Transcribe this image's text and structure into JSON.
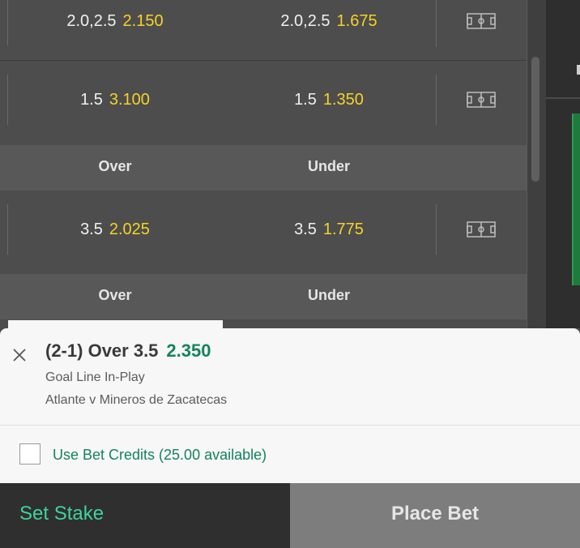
{
  "market": {
    "rows": [
      {
        "left_handicap": "2.0,2.5",
        "left_price": "2.150",
        "right_handicap": "2.0,2.5",
        "right_price": "1.675"
      },
      {
        "left_handicap": "1.5",
        "left_price": "3.100",
        "right_handicap": "1.5",
        "right_price": "1.350"
      },
      {
        "left_handicap": "3.5",
        "left_price": "2.025",
        "right_handicap": "3.5",
        "right_price": "1.775"
      }
    ],
    "headers": [
      {
        "left": "Over",
        "right": "Under"
      },
      {
        "left": "Over",
        "right": "Under"
      }
    ],
    "icon": "pitch-icon"
  },
  "betslip": {
    "selection_score": "(2-1)",
    "selection_name": "Over 3.5",
    "selection_price": "2.350",
    "market_name": "Goal Line In-Play",
    "event_name": "Atlante v Mineros de Zacatecas",
    "credits_label": "Use Bet Credits (25.00 available)",
    "credits_checked": false
  },
  "actions": {
    "set_stake_label": "Set Stake",
    "place_bet_label": "Place Bet"
  },
  "colors": {
    "price_yellow": "#f5d327",
    "accent_green": "#13845b",
    "stake_green": "#3fd39a"
  }
}
